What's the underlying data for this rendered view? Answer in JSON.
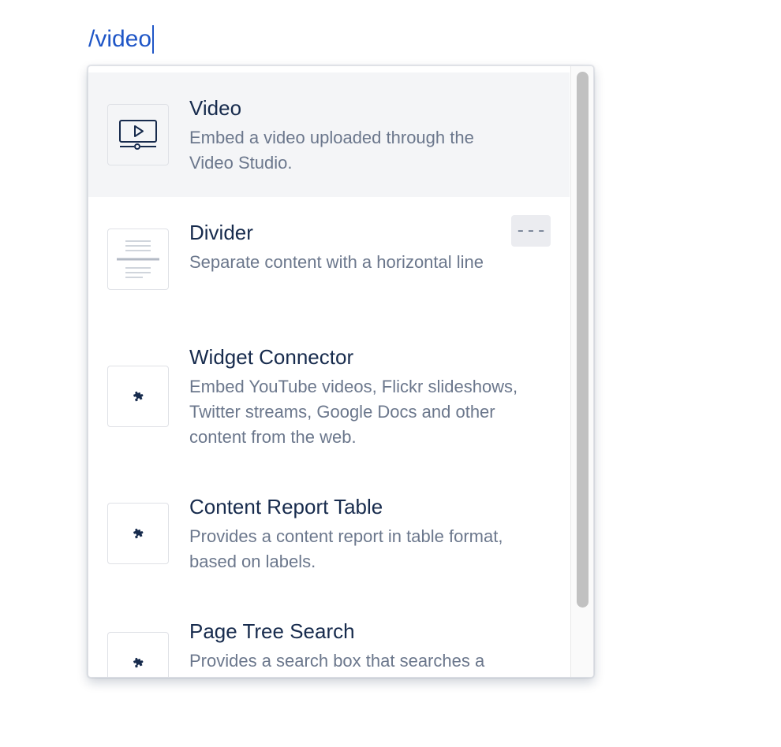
{
  "editor": {
    "typed_text": "/video"
  },
  "menu": {
    "items": [
      {
        "title": "Video",
        "description": "Embed a video uploaded through the Video Studio.",
        "icon": "video-player-icon",
        "selected": true
      },
      {
        "title": "Divider",
        "description": "Separate content with a horizontal line",
        "icon": "divider-icon",
        "shortcut": "---"
      },
      {
        "title": "Widget Connector",
        "description": "Embed YouTube videos, Flickr slideshows, Twitter streams, Google Docs and other content from the web.",
        "icon": "puzzle-piece-icon"
      },
      {
        "title": "Content Report Table",
        "description": "Provides a content report in table format, based on labels.",
        "icon": "puzzle-piece-icon"
      },
      {
        "title": "Page Tree Search",
        "description": "Provides a search box that searches a",
        "icon": "puzzle-piece-icon"
      }
    ]
  },
  "colors": {
    "link_blue": "#1f56c7",
    "title": "#172b4d",
    "description": "#6b778c",
    "selected_bg": "#f4f5f7"
  }
}
